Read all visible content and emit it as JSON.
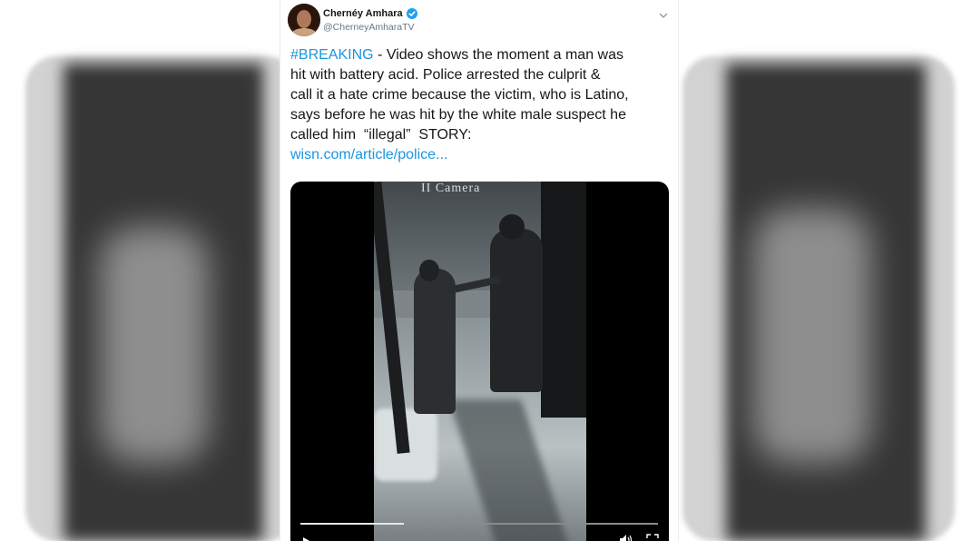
{
  "tweet": {
    "author_name": "Chernéy Amhara",
    "author_handle": "@CherneyAmharaTV",
    "hashtag": "#BREAKING",
    "text_lines": [
      " - Video shows the moment a man was",
      "hit with battery acid. Police arrested the culprit &",
      "call it a hate crime because the victim, who is Latino,",
      "says before he was hit by the white male suspect he",
      "called him  “illegal”  STORY:"
    ],
    "link_text": "wisn.com/article/police...",
    "link_color": "#1b95e0"
  },
  "video": {
    "overlay_text": "II Camera",
    "progress": 0.29
  },
  "icons": {
    "verified": "verified-badge-icon",
    "caret": "chevron-down-icon",
    "play": "play-icon",
    "volume": "volume-icon",
    "fullscreen": "fullscreen-icon"
  }
}
